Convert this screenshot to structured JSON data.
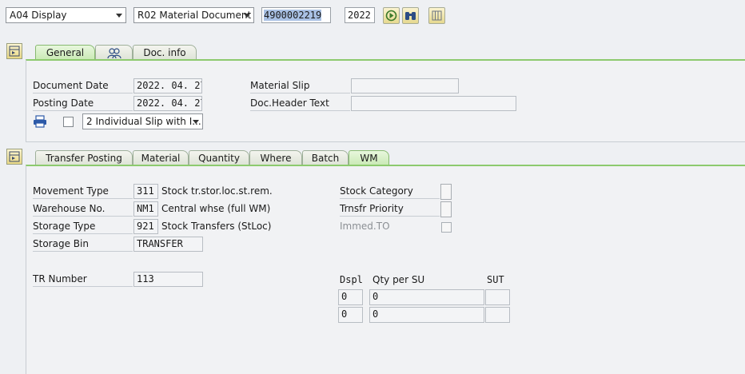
{
  "toolbar": {
    "action_value": "A04 Display",
    "reference_value": "R02 Material Document",
    "document_number": "4900002219",
    "year": "2022",
    "execute_icon": "execute-icon",
    "binoculars_icon": "binoculars-icon",
    "grid_icon": "grid-icon"
  },
  "header_tabs": [
    {
      "label": "General",
      "active": true
    },
    {
      "label": "",
      "icon": "partners-icon"
    },
    {
      "label": "Doc. info"
    }
  ],
  "header": {
    "document_date_label": "Document Date",
    "document_date": "2022. 04. 27",
    "posting_date_label": "Posting Date",
    "posting_date": "2022. 04. 27",
    "material_slip_label": "Material Slip",
    "material_slip": "",
    "doc_header_text_label": "Doc.Header Text",
    "doc_header_text": "",
    "print_option": "2 Individual Slip with I..."
  },
  "item_tabs": [
    {
      "label": "Transfer Posting"
    },
    {
      "label": "Material"
    },
    {
      "label": "Quantity"
    },
    {
      "label": "Where"
    },
    {
      "label": "Batch"
    },
    {
      "label": "WM",
      "active": true
    }
  ],
  "wm": {
    "movement_type_label": "Movement Type",
    "movement_type": "311",
    "movement_type_text": "Stock tr.stor.loc.st.rem.",
    "warehouse_label": "Warehouse No.",
    "warehouse": "NM1",
    "warehouse_text": "Central whse (full WM)",
    "storage_type_label": "Storage Type",
    "storage_type": "921",
    "storage_type_text": "Stock Transfers (StLoc)",
    "storage_bin_label": "Storage Bin",
    "storage_bin": "TRANSFER",
    "tr_number_label": "TR Number",
    "tr_number": "113",
    "stock_category_label": "Stock Category",
    "transfer_priority_label": "Trnsfr Priority",
    "immed_to_label": "Immed.TO",
    "su_table": {
      "col_dspl": "Dspl",
      "col_qty": "Qty per SU",
      "col_sut": "SUT",
      "rows": [
        {
          "dspl": "0",
          "qty": "0",
          "sut": ""
        },
        {
          "dspl": "0",
          "qty": "0",
          "sut": ""
        }
      ]
    }
  }
}
